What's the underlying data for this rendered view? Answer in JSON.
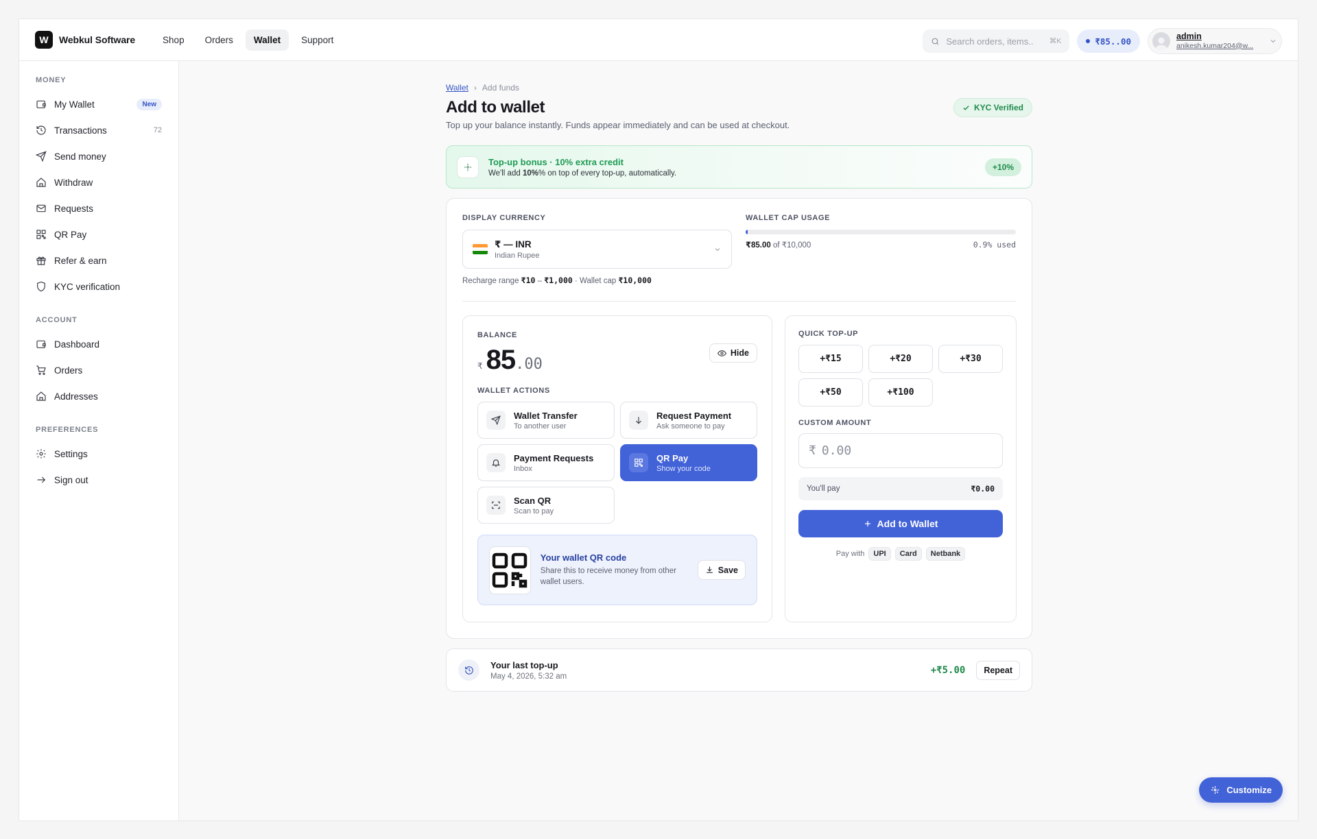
{
  "colors": {
    "accent": "#4262d8",
    "success": "#1f8a4c",
    "flag_saffron": "#ff9933",
    "flag_white": "#ffffff",
    "flag_green": "#138808"
  },
  "brand": {
    "logo_letter": "W",
    "name": "Webkul Software"
  },
  "topnav": [
    {
      "label": "Shop",
      "active": false
    },
    {
      "label": "Orders",
      "active": false
    },
    {
      "label": "Wallet",
      "active": true
    },
    {
      "label": "Support",
      "active": false
    }
  ],
  "search": {
    "placeholder": "Search orders, items..",
    "shortcut": "⌘K"
  },
  "header_balance": "₹85..00",
  "user": {
    "name": "admin",
    "email": "anikesh.kumar204@w..."
  },
  "sidebar": {
    "money_label": "MONEY",
    "money": [
      {
        "label": "My Wallet",
        "icon": "wallet-icon",
        "badge": "New"
      },
      {
        "label": "Transactions",
        "icon": "history-icon",
        "count": "72"
      },
      {
        "label": "Send money",
        "icon": "send-icon"
      },
      {
        "label": "Withdraw",
        "icon": "home-icon"
      },
      {
        "label": "Requests",
        "icon": "mail-icon"
      },
      {
        "label": "QR Pay",
        "icon": "qr-icon"
      },
      {
        "label": "Refer & earn",
        "icon": "gift-icon"
      },
      {
        "label": "KYC verification",
        "icon": "shield-icon"
      }
    ],
    "account_label": "ACCOUNT",
    "account": [
      {
        "label": "Dashboard",
        "icon": "wallet-icon"
      },
      {
        "label": "Orders",
        "icon": "cart-icon"
      },
      {
        "label": "Addresses",
        "icon": "home-icon"
      }
    ],
    "preferences_label": "PREFERENCES",
    "preferences": [
      {
        "label": "Settings",
        "icon": "gear-icon"
      },
      {
        "label": "Sign out",
        "icon": "arrow-right-icon"
      }
    ]
  },
  "breadcrumb": {
    "root": "Wallet",
    "current": "Add funds"
  },
  "page": {
    "title": "Add to wallet",
    "subtitle": "Top up your balance instantly. Funds appear immediately and can be used at checkout.",
    "kyc_badge": "KYC Verified"
  },
  "bonus": {
    "title": "Top-up bonus · 10% extra credit",
    "text_prefix": "We'll add ",
    "text_bold": "10%",
    "text_suffix": "% on top of every top-up, automatically.",
    "chip": "+10%"
  },
  "currency": {
    "label": "DISPLAY CURRENCY",
    "selected": "₹ — INR",
    "name": "Indian Rupee",
    "range_prefix": "Recharge range ",
    "range_min": "₹10",
    "range_sep": " – ",
    "range_max": "₹1,000",
    "cap_prefix": " · Wallet cap ",
    "cap_value": "₹10,000"
  },
  "cap_usage": {
    "label": "WALLET CAP USAGE",
    "used": "₹85.00",
    "of_text": " of ₹10,000",
    "percent_text": "0.9% used",
    "fraction": 0.0085
  },
  "balance": {
    "label": "BALANCE",
    "currency": "₹",
    "integer": "85",
    "decimal": ".00",
    "hide_label": "Hide"
  },
  "actions": {
    "label": "WALLET ACTIONS",
    "items": [
      {
        "title": "Wallet Transfer",
        "sub": "To another user",
        "icon": "send-icon"
      },
      {
        "title": "Request Payment",
        "sub": "Ask someone to pay",
        "icon": "arrow-down-icon"
      },
      {
        "title": "Payment Requests",
        "sub": "Inbox",
        "icon": "bell-icon"
      },
      {
        "title": "QR Pay",
        "sub": "Show your code",
        "icon": "qr-icon"
      },
      {
        "title": "Scan QR",
        "sub": "Scan to pay",
        "icon": "scan-icon"
      }
    ]
  },
  "qr_card": {
    "title": "Your wallet QR code",
    "text": "Share this to receive money from other wallet users.",
    "save_label": "Save"
  },
  "topup": {
    "quick_label": "QUICK TOP-UP",
    "quick": [
      "+₹15",
      "+₹20",
      "+₹30",
      "+₹50",
      "+₹100"
    ],
    "custom_label": "CUSTOM AMOUNT",
    "currency": "₹",
    "placeholder": "0.00",
    "pay_label": "You'll pay",
    "pay_value": "₹0.00",
    "add_label": "Add to Wallet",
    "pay_with": "Pay with",
    "methods": [
      "UPI",
      "Card",
      "Netbank"
    ]
  },
  "last_topup": {
    "title": "Your last top-up",
    "date": "May 4, 2026, 5:32 am",
    "amount": "+₹5.00",
    "repeat_label": "Repeat"
  },
  "customize_label": "Customize"
}
